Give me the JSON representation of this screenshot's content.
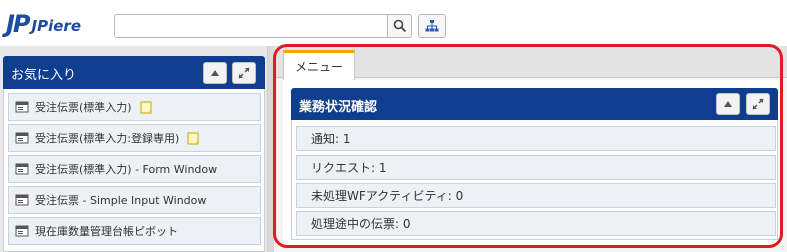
{
  "header": {
    "logo_mark": "JP",
    "logo_text": "JPiere",
    "search_value": ""
  },
  "left_panel": {
    "title": "お気に入り",
    "items": [
      {
        "label": "受注伝票(標準入力)",
        "has_note": true
      },
      {
        "label": "受注伝票(標準入力:登録専用)",
        "has_note": true
      },
      {
        "label": "受注伝票(標準入力) - Form Window",
        "has_note": false
      },
      {
        "label": "受注伝票 - Simple Input Window",
        "has_note": false
      },
      {
        "label": "現在庫数量管理台帳ピボット",
        "has_note": false
      }
    ]
  },
  "tabs": [
    {
      "label": "メニュー",
      "active": true
    }
  ],
  "widget": {
    "title": "業務状況確認",
    "rows": [
      {
        "label": "通知: 1"
      },
      {
        "label": "リクエスト: 1"
      },
      {
        "label": "未処理WFアクティビティ: 0"
      },
      {
        "label": "処理途中の伝票: 0"
      }
    ]
  },
  "colors": {
    "brand_blue": "#0f3e8f",
    "tab_accent": "#f5a400",
    "highlight": "#e01b24"
  },
  "icons": {
    "search": "search-icon",
    "tree": "sitemap-icon",
    "collapse": "chevron-up-icon",
    "maximize": "expand-icon",
    "window": "window-icon",
    "note": "sticky-note-icon"
  }
}
